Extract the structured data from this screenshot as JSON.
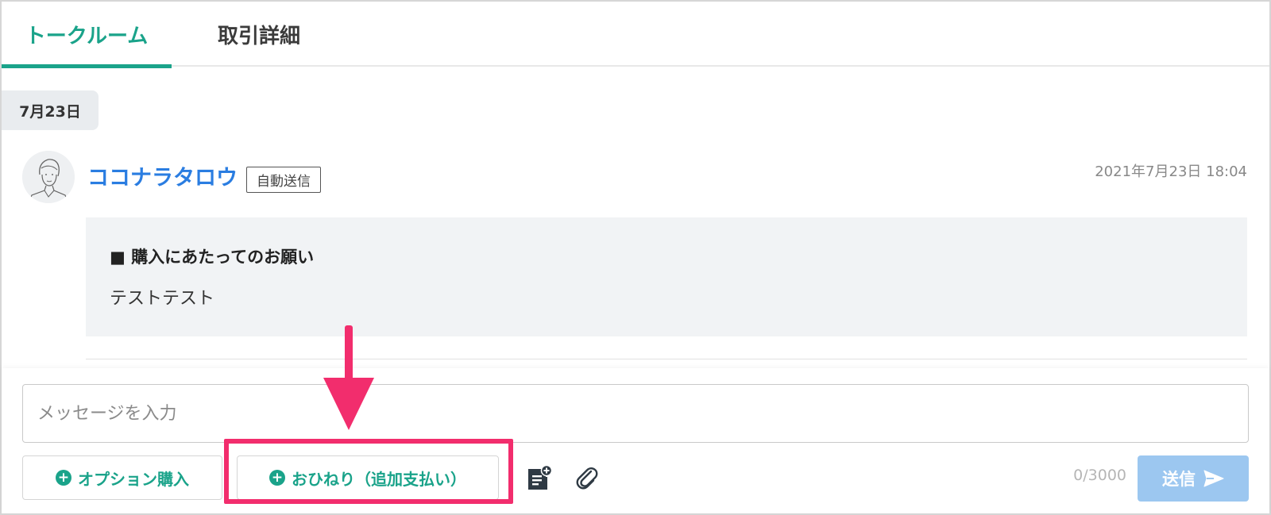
{
  "tabs": [
    {
      "label": "トークルーム",
      "active": true
    },
    {
      "label": "取引詳細",
      "active": false
    }
  ],
  "chat": {
    "date": "7月23日",
    "message": {
      "sender": "ココナラタロウ",
      "badge": "自動送信",
      "timestamp": "2021年7月23日 18:04",
      "title": "■ 購入にあたってのお願い",
      "body": "テストテスト"
    }
  },
  "composer": {
    "placeholder": "メッセージを入力",
    "option_label": "オプション購入",
    "tip_label": "おひねり（追加支払い）",
    "counter": "0/3000",
    "send_label": "送信"
  },
  "colors": {
    "accent": "#1aa38a",
    "link": "#2a7de1",
    "highlight": "#f22d6d",
    "send_disabled": "#9cc7f0"
  },
  "icons": [
    "plus-circle-icon",
    "template-icon",
    "paperclip-icon",
    "send-arrow-icon",
    "arrow-down-icon"
  ]
}
